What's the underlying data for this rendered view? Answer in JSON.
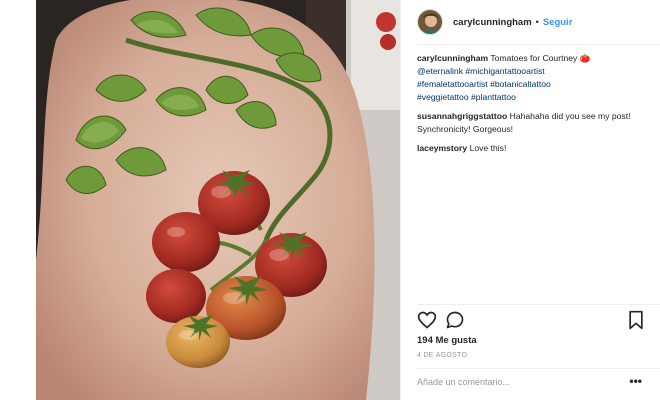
{
  "post": {
    "username": "carylcunningham",
    "separator": "•",
    "follow_label": "Seguir",
    "caption": {
      "username": "carylcunningham",
      "text": "Tomatoes for Courtney 🍅",
      "mention": "@eternalink",
      "tags_line1": "#michigantattooartist",
      "tags_line2": "#femaletattooartist #botanicaltattoo",
      "tags_line3": "#veggietattoo #planttattoo"
    },
    "comments": [
      {
        "username": "susannahgriggstattoo",
        "text": "Hahahaha did you see my post! Synchronicity! Gorgeous!"
      },
      {
        "username": "laceymstory",
        "text": "Love this!"
      }
    ],
    "likes": "194 Me gusta",
    "date": "4 DE AGOSTO",
    "add_comment_placeholder": "Añade un comentario...",
    "more_label": "•••",
    "icons": [
      "heart-icon",
      "comment-icon",
      "bookmark-icon",
      "more-options-icon"
    ],
    "colors": {
      "link": "#3897f0",
      "hashtag": "#003569",
      "text": "#262626",
      "muted": "#999999"
    }
  }
}
